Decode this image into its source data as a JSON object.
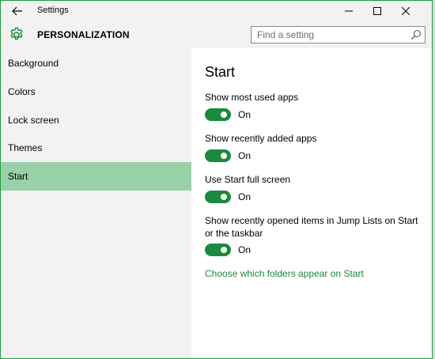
{
  "window": {
    "title": "Settings"
  },
  "header": {
    "title": "PERSONALIZATION",
    "search_placeholder": "Find a setting"
  },
  "sidebar": {
    "items": [
      {
        "label": "Background",
        "selected": false
      },
      {
        "label": "Colors",
        "selected": false
      },
      {
        "label": "Lock screen",
        "selected": false
      },
      {
        "label": "Themes",
        "selected": false
      },
      {
        "label": "Start",
        "selected": true
      }
    ]
  },
  "main": {
    "title": "Start",
    "settings": [
      {
        "label": "Show most used apps",
        "state": "On"
      },
      {
        "label": "Show recently added apps",
        "state": "On"
      },
      {
        "label": "Use Start full screen",
        "state": "On"
      },
      {
        "label": "Show recently opened items in Jump Lists on Start or the taskbar",
        "state": "On"
      }
    ],
    "link": "Choose which folders appear on Start"
  },
  "colors": {
    "accent": "#1a8a3c",
    "selected_nav": "#9ad0a7",
    "sidebar_bg": "#f2f2f2"
  },
  "icons": {
    "back": "back-arrow-icon",
    "minimize": "minimize-icon",
    "maximize": "maximize-icon",
    "close": "close-icon",
    "settings": "gear-icon",
    "search": "search-icon"
  }
}
